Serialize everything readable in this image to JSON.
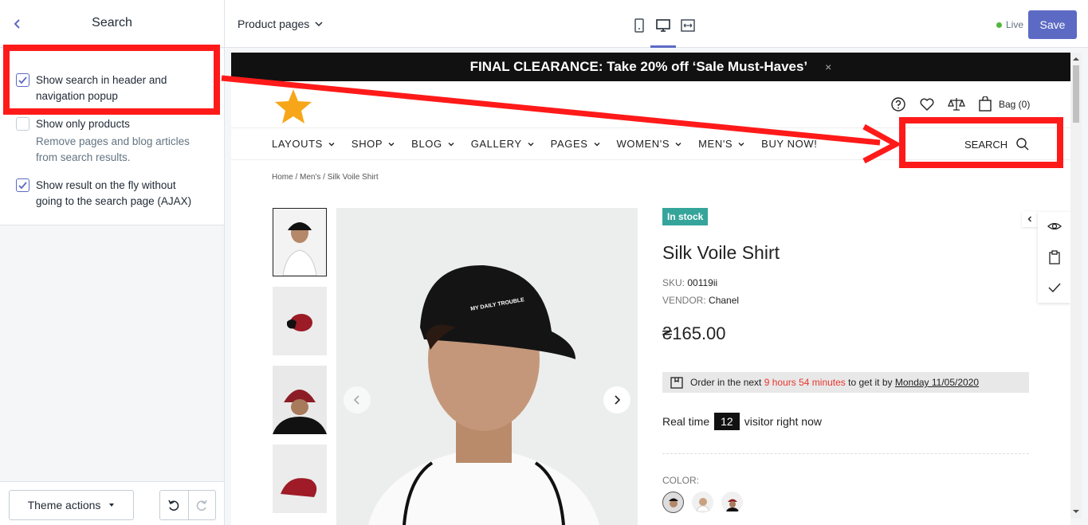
{
  "sidebar": {
    "title": "Search",
    "options": [
      {
        "label": "Show search in header and navigation popup",
        "checked": true
      },
      {
        "label": "Show only products",
        "checked": false,
        "help": "Remove pages and blog articles from search results."
      },
      {
        "label": "Show result on the fly without going to the search page (AJAX)",
        "checked": true
      }
    ],
    "footer": {
      "theme_actions": "Theme actions"
    }
  },
  "topbar": {
    "page_select": "Product pages",
    "live_label": "Live",
    "save_label": "Save",
    "accent": "#5c6ac4"
  },
  "store": {
    "announcement": "FINAL CLEARANCE: Take 20% off ‘Sale Must-Haves’",
    "announcement_close": "×",
    "bag_label": "Bag (0)",
    "nav": [
      "LAYOUTS",
      "SHOP",
      "BLOG",
      "GALLERY",
      "PAGES",
      "WOMEN'S",
      "MEN'S",
      "BUY NOW!"
    ],
    "search_label": "SEARCH",
    "breadcrumb": "Home  /  Men's  /  Silk Voile Shirt",
    "product": {
      "badge": "In stock",
      "title": "Silk Voile Shirt",
      "sku_label": "SKU:",
      "sku": "00119ii",
      "vendor_label": "VENDOR:",
      "vendor": "Chanel",
      "price": "₴165.00",
      "order_prefix": "Order in the next",
      "order_time": "9 hours 54 minutes",
      "order_mid": "to get it by",
      "order_date": "Monday 11/05/2020",
      "visitors_prefix": "Real time",
      "visitors_count": "12",
      "visitors_suffix": "visitor right now",
      "color_label": "COLOR:",
      "cap_text": "MY DAILY TROUBLE"
    }
  }
}
